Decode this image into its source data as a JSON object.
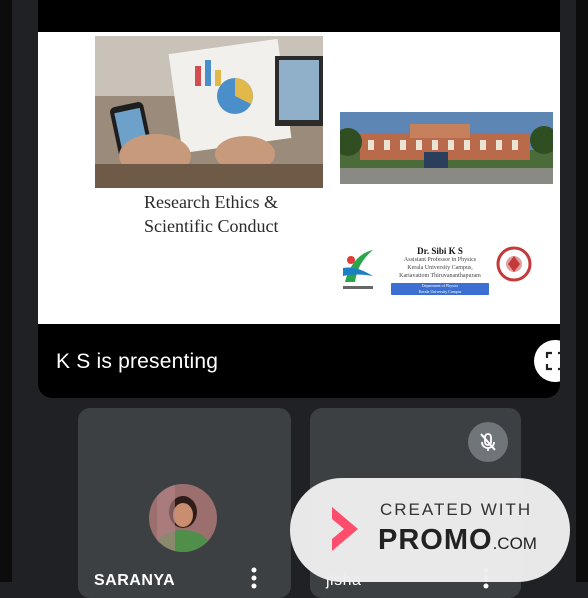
{
  "presentation": {
    "presenter_label": "K S is presenting",
    "slide": {
      "title_line1": "Research Ethics &",
      "title_line2": "Scientific Conduct",
      "author_name": "Dr. Sibi K S",
      "author_position": "Assistant Professor in Physics",
      "author_institution": "Kerala University Campus,",
      "author_location": "Kariavattom Thiruvananthapuram",
      "department_badge_line1": "Department of Physics",
      "department_badge_line2": "Kerala University Campus"
    }
  },
  "participants": [
    {
      "name": "SARANYA",
      "muted": false
    },
    {
      "name": "jisha",
      "muted": true
    }
  ],
  "watermark": {
    "created_with": "CREATED WITH",
    "brand": "PROMO",
    "brand_suffix": ".COM",
    "accent_color": "#ff4d6d"
  },
  "icons": {
    "fullscreen": "fullscreen-icon",
    "more": "more-vert-icon",
    "mic_off": "mic-off-icon"
  }
}
